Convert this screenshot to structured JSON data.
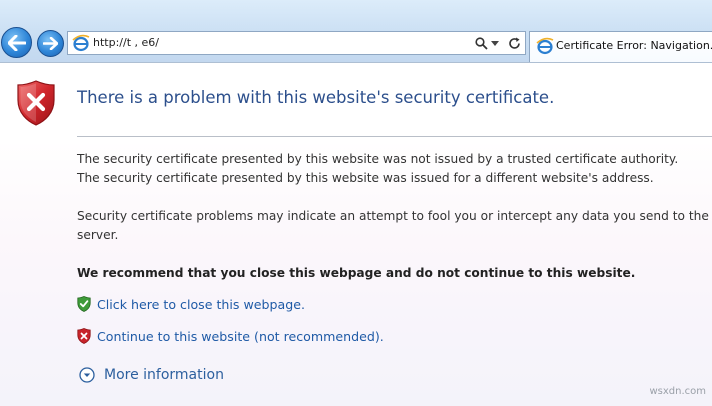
{
  "browser": {
    "address": {
      "url": "http://t   ,   e6/"
    },
    "tab": {
      "title": "Certificate Error: Navigation..."
    }
  },
  "content": {
    "headline": "There is a problem with this website's security certificate.",
    "paragraphs": [
      "The security certificate presented by this website was not issued by a trusted certificate authority.",
      "The security certificate presented by this website was issued for a different website's address.",
      "Security certificate problems may indicate an attempt to fool you or intercept any data you send to the",
      "server."
    ],
    "recommendation": "We recommend that you close this webpage and do not continue to this website.",
    "links": {
      "close": "Click here to close this webpage.",
      "continue": "Continue to this website (not recommended)."
    },
    "more_info": "More information"
  },
  "watermark": "wsxdn.com",
  "colors": {
    "headline": "#2c4f8c",
    "link": "#1f5aa6",
    "toolbar": "#c9def3",
    "error_shield": "#c8242b",
    "ok_shield": "#3f9b3a"
  }
}
